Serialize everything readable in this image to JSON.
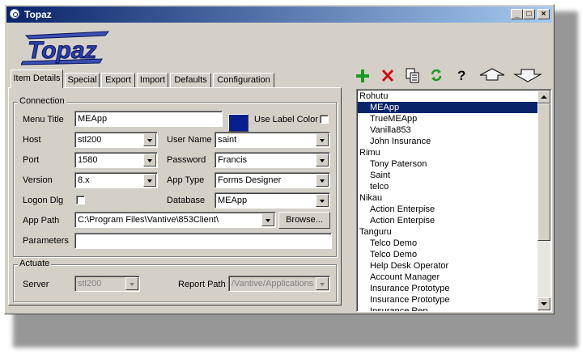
{
  "window": {
    "title": "Topaz",
    "logo_text": "Topaz"
  },
  "title_buttons": {
    "minimize": "_",
    "maximize": "□",
    "close": "×"
  },
  "tabs": [
    {
      "label": "Item Details",
      "active": true
    },
    {
      "label": "Special"
    },
    {
      "label": "Export"
    },
    {
      "label": "Import"
    },
    {
      "label": "Defaults"
    },
    {
      "label": "Configuration"
    }
  ],
  "toolbar": {
    "icons": [
      "add-icon",
      "delete-icon",
      "copy-icon",
      "refresh-icon",
      "help-icon",
      "move-up-icon",
      "move-down-icon"
    ],
    "add_color": "#1a9a1a",
    "delete_color": "#d01010",
    "help_label": "?"
  },
  "connection": {
    "legend": "Connection",
    "menu_title_label": "Menu Title",
    "menu_title_value": "MEApp",
    "label_color": "#0a1f8f",
    "use_label_color_label": "Use Label Color",
    "host_label": "Host",
    "host_value": "stl200",
    "user_name_label": "User Name",
    "user_name_value": "saint",
    "port_label": "Port",
    "port_value": "1580",
    "password_label": "Password",
    "password_value": "Francis",
    "version_label": "Version",
    "version_value": "8.x",
    "app_type_label": "App Type",
    "app_type_value": "Forms Designer",
    "logon_dlg_label": "Logon Dlg",
    "database_label": "Database",
    "database_value": "MEApp",
    "app_path_label": "App Path",
    "app_path_value": "C:\\Program Files\\Vantive\\853Client\\",
    "browse_label": "Browse...",
    "parameters_label": "Parameters",
    "parameters_value": ""
  },
  "actuate": {
    "legend": "Actuate",
    "server_label": "Server",
    "server_value": "stl200",
    "report_path_label": "Report Path",
    "report_path_value": "/Vantive/Applications"
  },
  "tree": {
    "groups": [
      {
        "name": "Rohutu",
        "items": [
          "MEApp",
          "TrueMEApp",
          "Vanilla853",
          "John Insurance"
        ]
      },
      {
        "name": "Rimu",
        "items": [
          "Tony Paterson",
          "Saint",
          "telco"
        ]
      },
      {
        "name": "Nikau",
        "items": [
          "Action Enterpise",
          "Action Enterpise"
        ]
      },
      {
        "name": "Tanguru",
        "items": [
          "Telco Demo",
          "Telco Demo",
          "Help Desk Operator",
          "Account Manager",
          "Insurance Prototype",
          "Insurance Prototype",
          "Insurance Rep"
        ]
      }
    ],
    "selected": "MEApp"
  }
}
